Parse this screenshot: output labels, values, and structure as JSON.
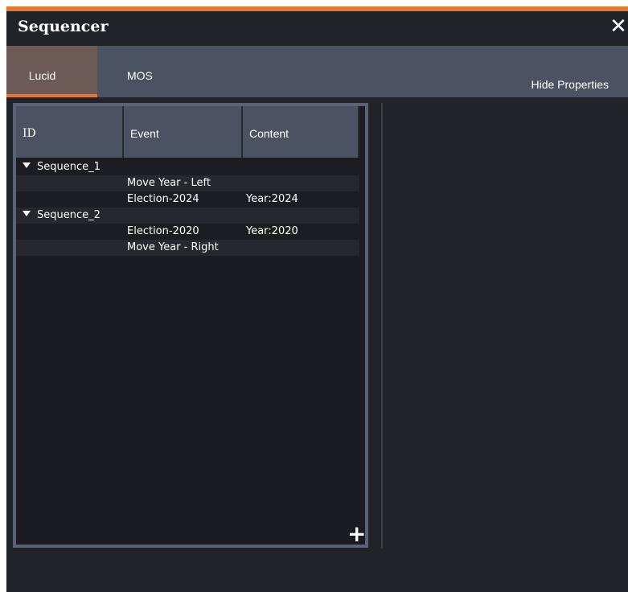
{
  "window": {
    "title": "Sequencer",
    "close_glyph": "✕",
    "accent_color": "#e8772e"
  },
  "tabs": [
    {
      "label": "Lucid",
      "active": true
    },
    {
      "label": "MOS",
      "active": false
    }
  ],
  "toolbar": {
    "hide_properties_label": "Hide Properties"
  },
  "grid": {
    "columns": [
      "ID",
      "Event",
      "Content"
    ],
    "rows": [
      {
        "id": "Sequence_1",
        "event": "",
        "content": "",
        "group": true
      },
      {
        "id": "",
        "event": "Move Year - Left",
        "content": "",
        "group": false
      },
      {
        "id": "",
        "event": "Election-2024",
        "content": "Year:2024",
        "group": false
      },
      {
        "id": "Sequence_2",
        "event": "",
        "content": "",
        "group": true
      },
      {
        "id": "",
        "event": "Election-2020",
        "content": "Year:2020",
        "group": false
      },
      {
        "id": "",
        "event": "Move Year - Right",
        "content": "",
        "group": false
      }
    ],
    "add_glyph": "+"
  },
  "icons": {
    "expand": "chevron-down-icon",
    "add": "plus-icon",
    "close": "close-icon"
  }
}
